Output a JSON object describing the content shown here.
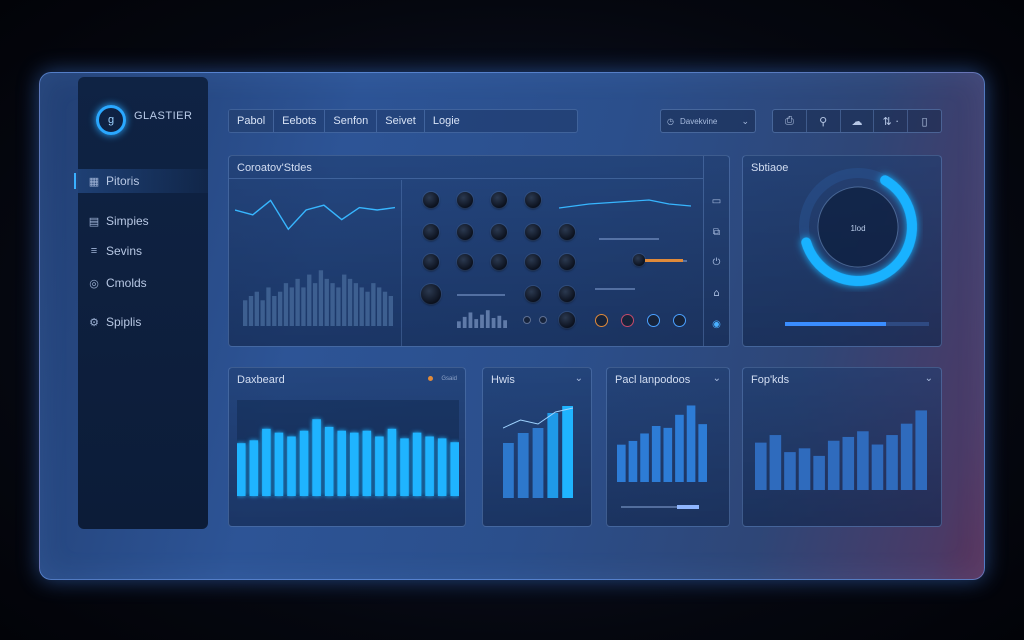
{
  "app": {
    "logo_text": "GLASTIER",
    "logo_glyph": "g"
  },
  "sidebar": {
    "items": [
      {
        "label": "Pitoris",
        "icon": "grid-icon",
        "active": true
      },
      {
        "label": "Simpies",
        "icon": "document-icon",
        "active": false
      },
      {
        "label": "Sevins",
        "icon": "list-icon",
        "active": false
      },
      {
        "label": "Cmolds",
        "icon": "circle-icon",
        "active": false
      },
      {
        "label": "Spiplis",
        "icon": "gear-icon",
        "active": false
      }
    ]
  },
  "tabs": [
    "Pabol",
    "Eebots",
    "Senfon",
    "Seivet",
    "Logie"
  ],
  "dropdown": {
    "value": "Davekvine"
  },
  "toolbar": {
    "buttons": [
      "⎙",
      "⚲",
      "☁",
      "⇅ ·",
      "▯"
    ]
  },
  "panels": {
    "controllers": {
      "title": "Coroatov'Stdes",
      "dial_value": ""
    },
    "status": {
      "title": "Sbtiaoe",
      "gauge_label": "1lod",
      "gauge_value": 0.62,
      "bar_value": 0.7
    },
    "dashboard": {
      "title": "Daxbeard",
      "legend": "Gsaid"
    },
    "hwis": {
      "title": "Hwis"
    },
    "feed": {
      "title": "Pacl lanpodoos"
    },
    "logs": {
      "title": "Fop'kds"
    }
  },
  "chart_data": [
    {
      "type": "line",
      "name": "controllers-line",
      "values": [
        30,
        28,
        34,
        22,
        30,
        32,
        26,
        31,
        30,
        31
      ]
    },
    {
      "type": "bar",
      "name": "controllers-bars",
      "values": [
        6,
        7,
        8,
        6,
        9,
        7,
        8,
        10,
        9,
        11,
        9,
        12,
        10,
        13,
        11,
        10,
        9,
        12,
        11,
        10,
        9,
        8,
        10,
        9,
        8,
        7
      ]
    },
    {
      "type": "bar",
      "name": "dashboard",
      "values": [
        55,
        58,
        70,
        66,
        62,
        68,
        80,
        72,
        68,
        66,
        68,
        62,
        70,
        60,
        66,
        62,
        60,
        56
      ]
    },
    {
      "type": "bar",
      "name": "hwis",
      "values": [
        55,
        65,
        70,
        85,
        92
      ],
      "line": [
        70,
        78,
        74,
        86,
        90
      ]
    },
    {
      "type": "bar",
      "name": "feed",
      "values": [
        40,
        44,
        52,
        60,
        58,
        72,
        82,
        62
      ]
    },
    {
      "type": "bar",
      "name": "logs",
      "values": [
        50,
        58,
        40,
        44,
        36,
        52,
        56,
        62,
        48,
        58,
        70,
        84
      ]
    }
  ],
  "colors": {
    "accent": "#2aa8ff",
    "bar": "#1fb4ff",
    "bar_dark": "#2d6fc0",
    "orange": "#e08a3a"
  }
}
